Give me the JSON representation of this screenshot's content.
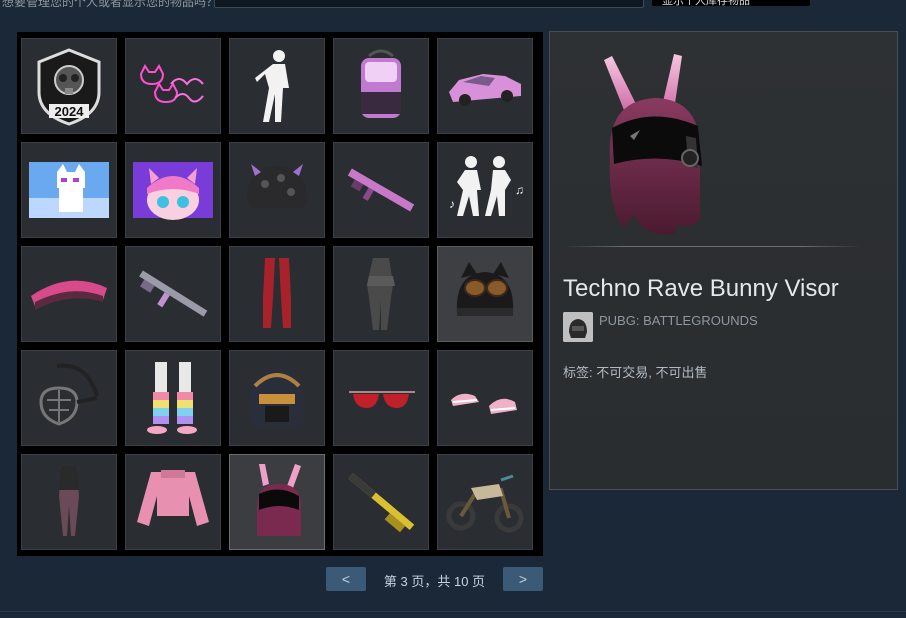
{
  "topbar": {
    "text": "想要管理您的个人或者显示您的物品吗？ 不同于您的物品",
    "button_label": "显示个人库存物品"
  },
  "grid": {
    "items": [
      {
        "name": "2024 gas mask emblem",
        "icon": "gas-mask-emblem-icon"
      },
      {
        "name": "Smile Angel neon cats",
        "icon": "neon-cats-icon"
      },
      {
        "name": "Emote pose",
        "icon": "emote-figure-icon"
      },
      {
        "name": "Pink backpack",
        "icon": "backpack-icon"
      },
      {
        "name": "Pink car skin",
        "icon": "car-icon"
      },
      {
        "name": "Pixel cat banner",
        "icon": "pixel-cat-banner-icon"
      },
      {
        "name": "Anime girl banner",
        "icon": "anime-banner-icon"
      },
      {
        "name": "Horned helmet",
        "icon": "horned-helmet-icon"
      },
      {
        "name": "Rifle skin",
        "icon": "rifle-icon"
      },
      {
        "name": "Dance emote",
        "icon": "dance-emote-icon"
      },
      {
        "name": "Pink glider",
        "icon": "glider-icon"
      },
      {
        "name": "Assault rifle skin",
        "icon": "assault-rifle-icon"
      },
      {
        "name": "Red leggings",
        "icon": "red-leggings-icon"
      },
      {
        "name": "Dark outfit",
        "icon": "dark-outfit-icon"
      },
      {
        "name": "Cat ear beanie with goggles",
        "icon": "beanie-icon"
      },
      {
        "name": "Muzzle mask",
        "icon": "muzzle-icon"
      },
      {
        "name": "Rainbow leg warmers",
        "icon": "leg-warmers-icon"
      },
      {
        "name": "Bronze helmet",
        "icon": "bronze-helmet-icon"
      },
      {
        "name": "Red sunglasses",
        "icon": "sunglasses-icon"
      },
      {
        "name": "Pink flats",
        "icon": "pink-shoes-icon"
      },
      {
        "name": "Bodysuit",
        "icon": "bodysuit-icon"
      },
      {
        "name": "Pink jacket",
        "icon": "pink-jacket-icon"
      },
      {
        "name": "Techno Rave Bunny Visor",
        "icon": "bunny-visor-icon"
      },
      {
        "name": "Yellow shotgun",
        "icon": "shotgun-icon"
      },
      {
        "name": "Dirt bike",
        "icon": "dirt-bike-icon"
      }
    ],
    "selected_index": 22
  },
  "pagination": {
    "prev_label": "<",
    "next_label": ">",
    "status": "第 3 页，共 10 页"
  },
  "detail": {
    "item_name": "Techno Rave Bunny Visor",
    "game_name": "PUBG: BATTLEGROUNDS",
    "tags": "标签: 不可交易, 不可出售"
  }
}
